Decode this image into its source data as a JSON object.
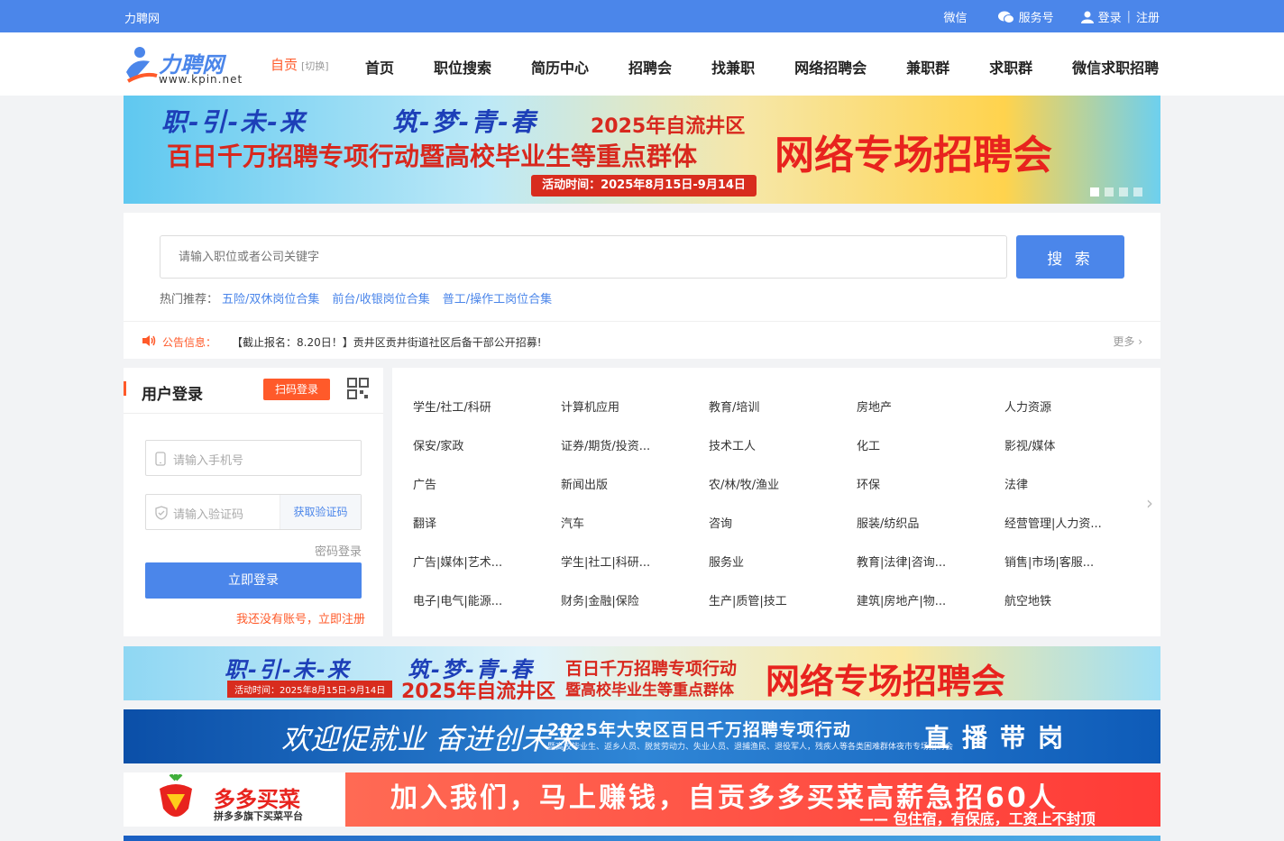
{
  "topbar": {
    "brand": "力聘网",
    "wechat": "微信",
    "service": "服务号",
    "login": "登录",
    "register": "注册"
  },
  "header": {
    "logo_text": "力聘网",
    "logo_url": "www.kpin.net",
    "city": "自贡",
    "switch": "[切换]",
    "nav": [
      "首页",
      "职位搜索",
      "简历中心",
      "招聘会",
      "找兼职",
      "网络招聘会",
      "兼职群",
      "求职群",
      "微信求职招聘"
    ]
  },
  "banner": {
    "slogan1": "职-引-未-来",
    "slogan2": "筑-梦-青-春",
    "year_city": "2025年自流井区",
    "line2": "百日千万招聘专项行动暨高校毕业生等重点群体",
    "headline": "网络专场招聘会",
    "date": "活动时间：2025年8月15日-9月14日"
  },
  "search": {
    "placeholder": "请输入职位或者公司关键字",
    "button": "搜 索",
    "hot_label": "热门推荐：",
    "hot_tags": [
      "五险/双休岗位合集",
      "前台/收银岗位合集",
      "普工/操作工岗位合集"
    ]
  },
  "notice": {
    "label": "公告信息：",
    "message": "【截止报名：8.20日！】贡井区贡井街道社区后备干部公开招募!",
    "more": "更多"
  },
  "login": {
    "title": "用户登录",
    "qr_button": "扫码登录",
    "phone_placeholder": "请输入手机号",
    "code_placeholder": "请输入验证码",
    "get_code": "获取验证码",
    "password_login": "密码登录",
    "submit": "立即登录",
    "register_prompt": "我还没有账号，立即注册"
  },
  "categories": [
    [
      "学生/社工/科研",
      "计算机应用",
      "教育/培训",
      "房地产",
      "人力资源"
    ],
    [
      "保安/家政",
      "证券/期货/投资...",
      "技术工人",
      "化工",
      "影视/媒体"
    ],
    [
      "广告",
      "新闻出版",
      "农/林/牧/渔业",
      "环保",
      "法律"
    ],
    [
      "翻译",
      "汽车",
      "咨询",
      "服装/纺织品",
      "经营管理|人力资..."
    ],
    [
      "广告|媒体|艺术...",
      "学生|社工|科研...",
      "服务业",
      "教育|法律|咨询...",
      "销售|市场|客服..."
    ],
    [
      "电子|电气|能源...",
      "财务|金融|保险",
      "生产|质管|技工",
      "建筑|房地产|物...",
      "航空地铁"
    ]
  ],
  "ads": {
    "ad1": {
      "slogan1": "职-引-未-来",
      "slogan2": "筑-梦-青-春",
      "year_city": "2025年自流井区",
      "line1": "百日千万招聘专项行动",
      "line2": "暨高校毕业生等重点群体",
      "headline": "网络专场招聘会",
      "date": "活动时间：2025年8月15日-9月14日"
    },
    "ad2": {
      "slogan": "欢迎促就业 奋进创未来",
      "title": "2025年大安区百日千万招聘专项行动",
      "sub": "暨高校毕业生、返乡人员、脱贫劳动力、失业人员、退捕渔民、退役军人，残疾人等各类困难群体夜市专场招聘会",
      "live": "直播带岗"
    },
    "ad3": {
      "brand": "多多买菜",
      "brand_sub": "拼多多旗下买菜平台",
      "headline": "加入我们，马上赚钱，自贡多多买菜高薪急招60人",
      "sub": "—— 包住宿，有保底，工资上不封顶"
    }
  },
  "colors": {
    "primary": "#4b86ea",
    "accent": "#ff5a2a"
  }
}
